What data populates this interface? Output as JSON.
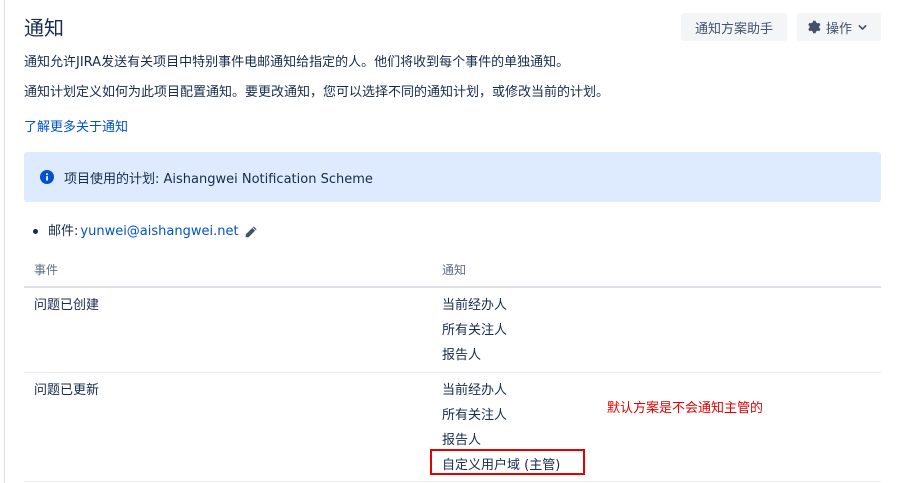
{
  "header": {
    "title": "通知",
    "helper_button": "通知方案助手",
    "actions_button": "操作"
  },
  "description": {
    "line1": "通知允许JIRA发送有关项目中特别事件电邮通知给指定的人。他们将收到每个事件的单独通知。",
    "line2": "通知计划定义如何为此项目配置通知。要更改通知，您可以选择不同的通知计划，或修改当前的计划。",
    "learn_more": "了解更多关于通知"
  },
  "info_panel": {
    "text": "项目使用的计划: Aishangwei Notification Scheme"
  },
  "email": {
    "label": "邮件:",
    "address": "yunwei@aishangwei.net"
  },
  "table": {
    "headers": {
      "event": "事件",
      "notification": "通知"
    },
    "rows": [
      {
        "event": "问题已创建",
        "notifications": [
          "当前经办人",
          "所有关注人",
          "报告人"
        ]
      },
      {
        "event": "问题已更新",
        "notifications": [
          "当前经办人",
          "所有关注人",
          "报告人",
          "自定义用户域 (主管)"
        ]
      }
    ]
  },
  "annotation": {
    "text": "默认方案是不会通知主管的",
    "color": "#e60000"
  },
  "colors": {
    "link": "#0052cc",
    "info_bg": "#deebff",
    "text": "#172b4d",
    "muted": "#5e6c84"
  }
}
